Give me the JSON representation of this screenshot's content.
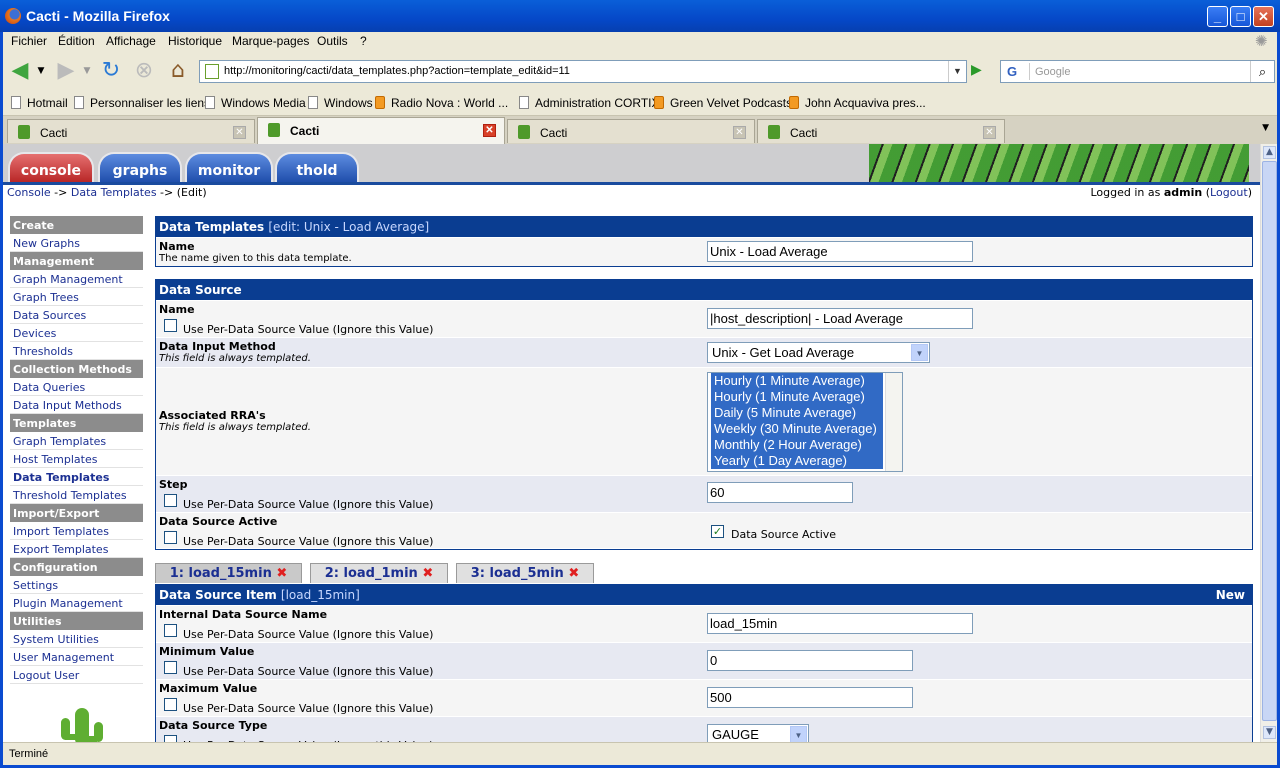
{
  "window": {
    "title": "Cacti - Mozilla Firefox"
  },
  "menu": [
    "Fichier",
    "Édition",
    "Affichage",
    "Historique",
    "Marque-pages",
    "Outils",
    "?"
  ],
  "address": {
    "url": "http://monitoring/cacti/data_templates.php?action=template_edit&id=11"
  },
  "search": {
    "engine": "G",
    "placeholder": "Google"
  },
  "bookmarks": [
    "Hotmail",
    "Personnaliser les liens",
    "Windows Media",
    "Windows",
    "Radio Nova : World ...",
    "Administration CORTIX",
    "Green Velvet Podcasts",
    "John Acquaviva pres..."
  ],
  "browser_tabs": [
    "Cacti",
    "Cacti",
    "Cacti",
    "Cacti"
  ],
  "cacti_tabs": [
    "console",
    "graphs",
    "monitor",
    "thold"
  ],
  "breadcrumb": {
    "console": "Console",
    "sep": "->",
    "templates": "Data Templates",
    "edit": "(Edit)"
  },
  "login": {
    "prefix": "Logged in as",
    "user": "admin",
    "logout": "Logout"
  },
  "sidebar": {
    "create": "Create",
    "new_graphs": "New Graphs",
    "management": "Management",
    "graph_management": "Graph Management",
    "graph_trees": "Graph Trees",
    "data_sources": "Data Sources",
    "devices": "Devices",
    "thresholds": "Thresholds",
    "collection_methods": "Collection Methods",
    "data_queries": "Data Queries",
    "data_input_methods": "Data Input Methods",
    "templates": "Templates",
    "graph_templates": "Graph Templates",
    "host_templates": "Host Templates",
    "data_templates": "Data Templates",
    "threshold_templates": "Threshold Templates",
    "import_export": "Import/Export",
    "import_templates": "Import Templates",
    "export_templates": "Export Templates",
    "configuration": "Configuration",
    "settings": "Settings",
    "plugin_management": "Plugin Management",
    "utilities": "Utilities",
    "system_utilities": "System Utilities",
    "user_management": "User Management",
    "logout_user": "Logout User"
  },
  "template_panel": {
    "title": "Data Templates",
    "subtitle": "[edit: Unix - Load Average]",
    "name_label": "Name",
    "name_desc": "The name given to this data template.",
    "name_value": "Unix - Load Average"
  },
  "ds_panel": {
    "title": "Data Source",
    "name_label": "Name",
    "per_ds": "Use Per-Data Source Value (Ignore this Value)",
    "name_value": "|host_description| - Load Average",
    "input_label": "Data Input Method",
    "templated": "This field is always templated.",
    "input_value": "Unix - Get Load Average",
    "rra_label": "Associated RRA's",
    "rras": [
      "Hourly (1 Minute Average)",
      "Hourly (1 Minute Average)",
      "Daily (5 Minute Average)",
      "Weekly (30 Minute Average)",
      "Monthly (2 Hour Average)",
      "Yearly (1 Day Average)"
    ],
    "step_label": "Step",
    "step_value": "60",
    "active_label": "Data Source Active",
    "active_check": "Data Source Active"
  },
  "item_tabs": [
    {
      "label": "1: load_15min"
    },
    {
      "label": "2: load_1min"
    },
    {
      "label": "3: load_5min"
    }
  ],
  "item_panel": {
    "title": "Data Source Item",
    "subtitle": "[load_15min]",
    "new": "New",
    "internal_label": "Internal Data Source Name",
    "internal_value": "load_15min",
    "min_label": "Minimum Value",
    "min_value": "0",
    "max_label": "Maximum Value",
    "max_value": "500",
    "type_label": "Data Source Type",
    "type_value": "GAUGE",
    "per_ds": "Use Per-Data Source Value (Ignore this Value)"
  },
  "status": "Terminé"
}
